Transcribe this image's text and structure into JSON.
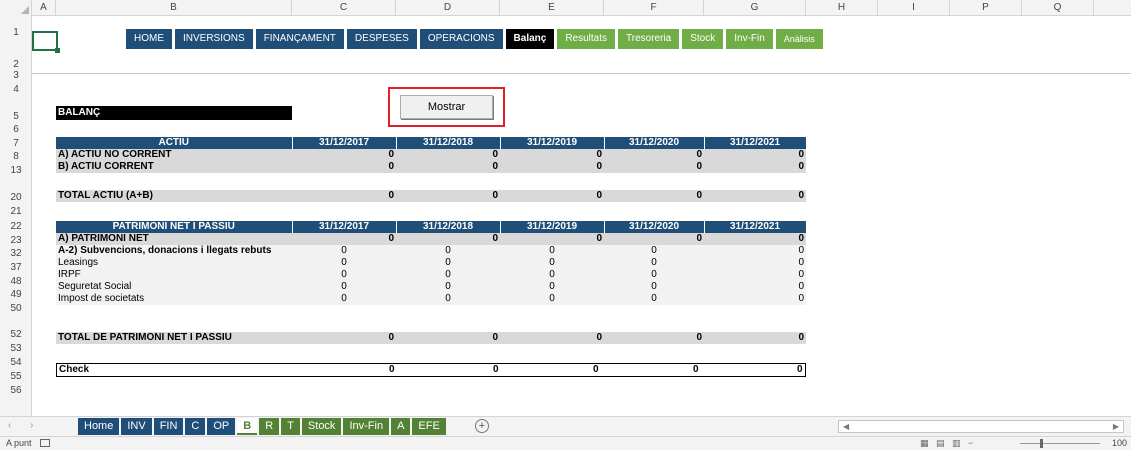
{
  "columns": [
    "A",
    "B",
    "C",
    "D",
    "E",
    "F",
    "G",
    "H",
    "I",
    "P",
    "Q"
  ],
  "rows": [
    "1",
    "2",
    "3",
    "4",
    "5",
    "6",
    "7",
    "8",
    "13",
    "20",
    "21",
    "22",
    "23",
    "32",
    "37",
    "48",
    "49",
    "50",
    "52",
    "53",
    "54",
    "55",
    "56"
  ],
  "nav": [
    {
      "label": "HOME",
      "style": "blue"
    },
    {
      "label": "INVERSIONS",
      "style": "blue"
    },
    {
      "label": "FINANÇAMENT",
      "style": "blue"
    },
    {
      "label": "DESPESES",
      "style": "blue"
    },
    {
      "label": "OPERACIONS",
      "style": "blue"
    },
    {
      "label": "Balanç",
      "style": "black"
    },
    {
      "label": "Resultats",
      "style": "green"
    },
    {
      "label": "Tresoreria",
      "style": "green"
    },
    {
      "label": "Stock",
      "style": "green"
    },
    {
      "label": "Inv-Fin",
      "style": "green"
    },
    {
      "label": "Anàlisis",
      "style": "green"
    }
  ],
  "title": "BALANÇ",
  "mostrar_label": "Mostrar",
  "dates": [
    "31/12/2017",
    "31/12/2018",
    "31/12/2019",
    "31/12/2020",
    "31/12/2021"
  ],
  "actiu": {
    "header": "ACTIU",
    "rows": [
      {
        "label": "A) ACTIU NO CORRENT",
        "values": [
          "0",
          "0",
          "0",
          "0",
          "0"
        ],
        "style": "gray"
      },
      {
        "label": "B) ACTIU CORRENT",
        "values": [
          "0",
          "0",
          "0",
          "0",
          "0"
        ],
        "style": "gray"
      }
    ],
    "total": {
      "label": "TOTAL ACTIU (A+B)",
      "values": [
        "0",
        "0",
        "0",
        "0",
        "0"
      ]
    }
  },
  "passiu": {
    "header": "PATRIMONI NET I PASSIU",
    "rows": [
      {
        "label": "A) PATRIMONI NET",
        "values": [
          "0",
          "0",
          "0",
          "0",
          "0"
        ],
        "style": "gray"
      },
      {
        "label": "A-2) Subvencions, donacions i llegats rebuts",
        "values": [
          "0",
          "0",
          "0",
          "0",
          "0"
        ],
        "style": "bold"
      },
      {
        "label": "Leasings",
        "values": [
          "0",
          "0",
          "0",
          "0",
          "0"
        ],
        "style": "light"
      },
      {
        "label": "IRPF",
        "values": [
          "0",
          "0",
          "0",
          "0",
          "0"
        ],
        "style": "light"
      },
      {
        "label": "Seguretat Social",
        "values": [
          "0",
          "0",
          "0",
          "0",
          "0"
        ],
        "style": "light"
      },
      {
        "label": "Impost de societats",
        "values": [
          "0",
          "0",
          "0",
          "0",
          "0"
        ],
        "style": "light"
      }
    ],
    "total": {
      "label": "TOTAL DE PATRIMONI NET I PASSIU",
      "values": [
        "0",
        "0",
        "0",
        "0",
        "0"
      ]
    }
  },
  "check": {
    "label": "Check",
    "values": [
      "0",
      "0",
      "0",
      "0",
      "0"
    ]
  },
  "tabs": [
    {
      "label": "Home",
      "style": "blue"
    },
    {
      "label": "INV",
      "style": "blue"
    },
    {
      "label": "FIN",
      "style": "blue"
    },
    {
      "label": "C",
      "style": "blue"
    },
    {
      "label": "OP",
      "style": "blue"
    },
    {
      "label": "B",
      "style": "active"
    },
    {
      "label": "R",
      "style": "green"
    },
    {
      "label": "T",
      "style": "green"
    },
    {
      "label": "Stock",
      "style": "green"
    },
    {
      "label": "Inv-Fin",
      "style": "green"
    },
    {
      "label": "A",
      "style": "green"
    },
    {
      "label": "EFE",
      "style": "green"
    }
  ],
  "status": {
    "ready": "A punt",
    "zoom": "100"
  },
  "colors": {
    "navy": "#1f4e79",
    "green": "#70ad47",
    "darkgreen": "#548235",
    "highlight": "#e0202a"
  }
}
